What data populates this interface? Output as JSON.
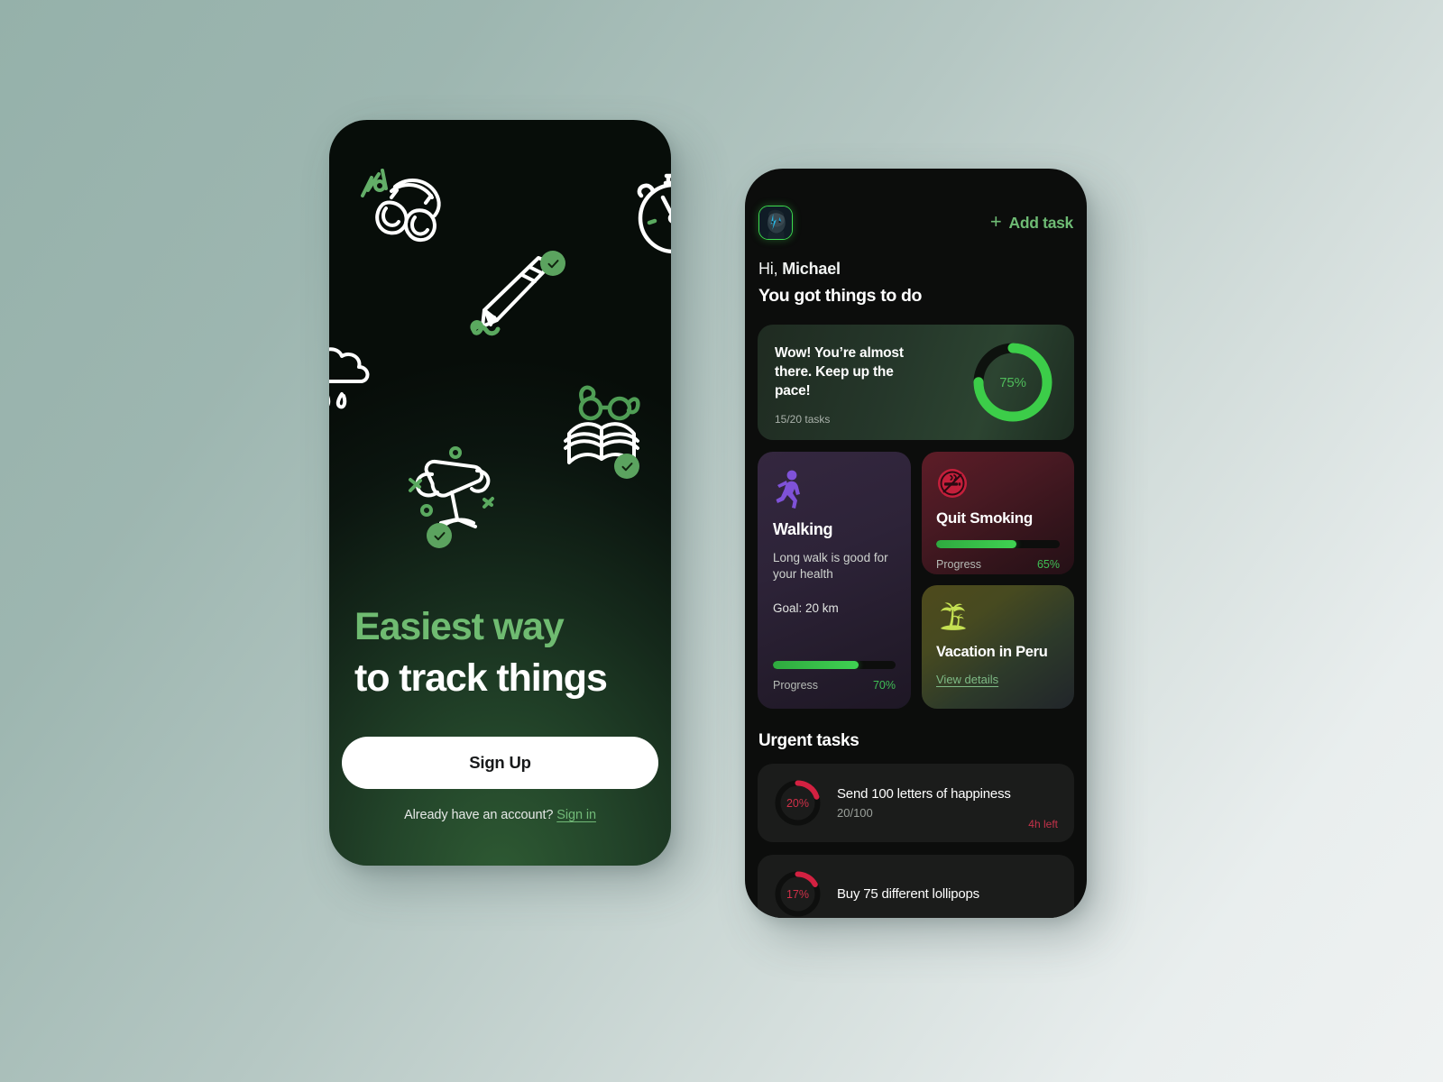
{
  "canvas": {
    "bg_from": "#95b1aa",
    "bg_to": "#eff2f2"
  },
  "onboarding": {
    "headline_green": "Easiest way",
    "headline_white": "to track things",
    "signup_label": "Sign Up",
    "account_prompt": "Already have an account?",
    "signin_label": "Sign in",
    "accent_green": "#6fbb71",
    "check_green": "#5ba35f",
    "doodles": [
      {
        "name": "headphones-doodle",
        "checked": false
      },
      {
        "name": "stopwatch-doodle",
        "checked": false
      },
      {
        "name": "pencil-doodle",
        "checked": true
      },
      {
        "name": "rain-cloud-doodle",
        "checked": false
      },
      {
        "name": "book-glasses-doodle",
        "checked": true
      },
      {
        "name": "trophy-doodle",
        "checked": true
      }
    ]
  },
  "dashboard": {
    "add_task_label": "Add task",
    "add_task_icon": "plus-icon",
    "avatar_alt": "user-avatar",
    "greeting_prefix": "Hi, ",
    "greeting_name": "Michael",
    "greeting_sub": "You got things to do",
    "progress_card": {
      "message": "Wow! You’re almost there. Keep up the pace!",
      "tasks_label": "15/20 tasks",
      "percent_label": "75%",
      "percent": 75,
      "ring_color": "#3ccd49",
      "ring_track": "#111411"
    },
    "walking_card": {
      "icon": "walking-person-icon",
      "title": "Walking",
      "description": "Long walk is good for your health",
      "goal": "Goal: 20 km",
      "progress_label": "Progress",
      "progress_value": "70%",
      "progress_percent": 70
    },
    "smoking_card": {
      "icon": "no-smoking-icon",
      "title": "Quit Smoking",
      "progress_label": "Progress",
      "progress_value": "65%",
      "progress_percent": 65
    },
    "vacation_card": {
      "icon": "palm-tree-icon",
      "title": "Vacation in Peru",
      "link_label": "View details"
    },
    "urgent": {
      "heading": "Urgent tasks",
      "tasks": [
        {
          "percent_label": "20%",
          "percent": 20,
          "title": "Send 100 letters of happiness",
          "subtitle": "20/100",
          "time_left": "4h left"
        },
        {
          "percent_label": "17%",
          "percent": 17,
          "title": "Buy 75 different lollipops",
          "subtitle": "",
          "time_left": ""
        }
      ]
    }
  }
}
